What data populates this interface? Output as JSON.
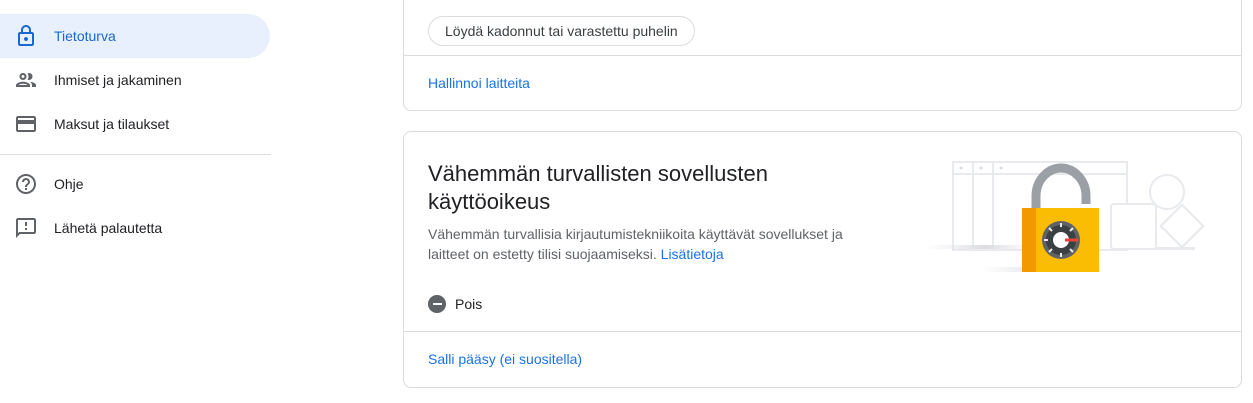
{
  "sidebar": {
    "items": [
      {
        "label": "Tietoturva",
        "icon": "lock-icon",
        "active": true
      },
      {
        "label": "Ihmiset ja jakaminen",
        "icon": "people-icon"
      },
      {
        "label": "Maksut ja tilaukset",
        "icon": "credit-card-icon"
      },
      {
        "label": "Ohje",
        "icon": "help-icon"
      },
      {
        "label": "Lähetä palautetta",
        "icon": "feedback-icon"
      }
    ]
  },
  "devices_card": {
    "find_phone_button": "Löydä kadonnut tai varastettu puhelin",
    "manage_link": "Hallinnoi laitteita"
  },
  "less_secure_card": {
    "title": "Vähemmän turvallisten sovellusten käyttöoikeus",
    "description": "Vähemmän turvallisia kirjautumistekniikoita käyttävät sovellukset ja laitteet on estetty tilisi suojaamiseksi.",
    "learn_more_link": "Lisätietoja",
    "status": "Pois",
    "allow_link": "Salli pääsy (ei suositella)"
  },
  "colors": {
    "accent": "#1a73e8",
    "active_nav_bg": "#e8f0fe",
    "lock_yellow": "#fbbc04"
  }
}
